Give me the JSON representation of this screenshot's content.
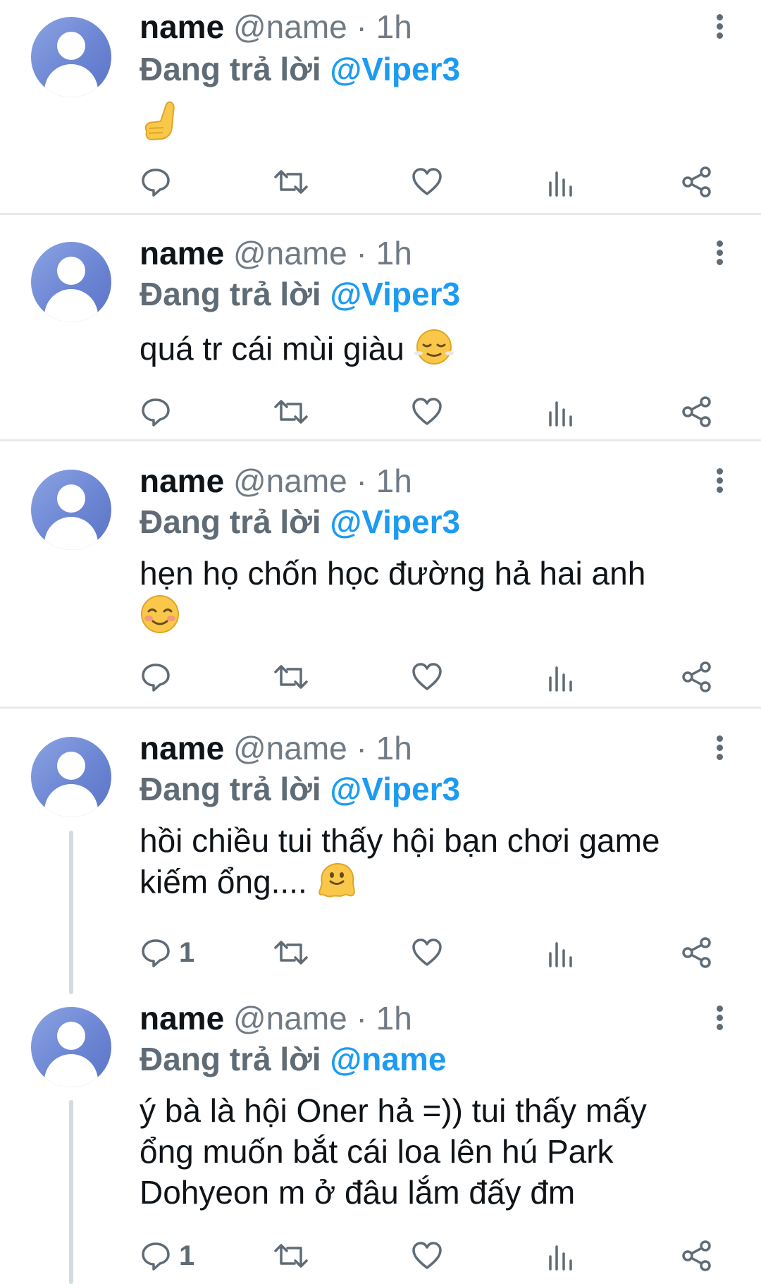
{
  "tweets": [
    {
      "name": "name",
      "handle": "@name",
      "separator": "·",
      "time": "1h",
      "reply_prefix": "Đang trả lời",
      "reply_to": "@Viper3",
      "text": "",
      "emoji": "hand-gesture",
      "reply_count": "",
      "icons": [
        "reply-icon",
        "retweet-icon",
        "like-icon",
        "views-icon",
        "share-icon"
      ]
    },
    {
      "name": "name",
      "handle": "@name",
      "separator": "·",
      "time": "1h",
      "reply_prefix": "Đang trả lời",
      "reply_to": "@Viper3",
      "text": "quá tr cái mùi giàu",
      "emoji": "relieved-face",
      "reply_count": "",
      "icons": [
        "reply-icon",
        "retweet-icon",
        "like-icon",
        "views-icon",
        "share-icon"
      ]
    },
    {
      "name": "name",
      "handle": "@name",
      "separator": "·",
      "time": "1h",
      "reply_prefix": "Đang trả lời",
      "reply_to": "@Viper3",
      "text": "hẹn họ chốn học đường hả hai anh",
      "emoji": "smiling-blushing-face",
      "reply_count": "",
      "icons": [
        "reply-icon",
        "retweet-icon",
        "like-icon",
        "views-icon",
        "share-icon"
      ]
    },
    {
      "name": "name",
      "handle": "@name",
      "separator": "·",
      "time": "1h",
      "reply_prefix": "Đang trả lời",
      "reply_to": "@Viper3",
      "text_lines": [
        "hồi chiều tui thấy hội bạn chơi game",
        "kiếm ổng...."
      ],
      "emoji": "melting-face",
      "reply_count": "1",
      "icons": [
        "reply-icon",
        "retweet-icon",
        "like-icon",
        "views-icon",
        "share-icon"
      ]
    },
    {
      "name": "name",
      "handle": "@name",
      "separator": "·",
      "time": "1h",
      "reply_prefix": "Đang trả lời",
      "reply_to": "@name",
      "text_lines": [
        "ý bà là hội Oner hả =)) tui thấy mấy",
        "ổng muốn bắt cái loa lên hú Park",
        "Dohyeon m ở đâu lắm đấy đm"
      ],
      "emoji": "",
      "reply_count": "1",
      "icons": [
        "reply-icon",
        "retweet-icon",
        "like-icon",
        "views-icon",
        "share-icon"
      ]
    }
  ],
  "colors": {
    "accent": "#1d9bf0",
    "secondary_text": "#6f7a84",
    "divider": "#e6e9eb",
    "avatar": "#6c86d4"
  }
}
